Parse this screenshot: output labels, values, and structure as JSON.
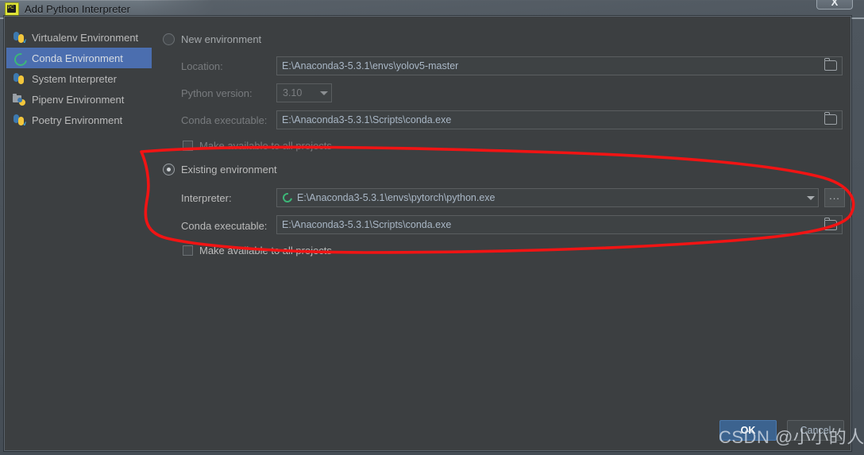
{
  "window": {
    "title": "Add Python Interpreter",
    "app_icon": "pycharm-icon",
    "close_label": "X"
  },
  "sidebar": {
    "items": [
      {
        "label": "Virtualenv Environment",
        "icon": "virtualenv-icon",
        "selected": false
      },
      {
        "label": "Conda Environment",
        "icon": "conda-icon",
        "selected": true
      },
      {
        "label": "System Interpreter",
        "icon": "python-icon",
        "selected": false
      },
      {
        "label": "Pipenv Environment",
        "icon": "pipenv-icon",
        "selected": false
      },
      {
        "label": "Poetry Environment",
        "icon": "poetry-icon",
        "selected": false
      }
    ]
  },
  "new_environment": {
    "radio_label": "New environment",
    "selected": false,
    "location_label": "Location:",
    "location_value": "E:\\Anaconda3-5.3.1\\envs\\yolov5-master",
    "python_version_label": "Python version:",
    "python_version_value": "3.10",
    "conda_executable_label": "Conda executable:",
    "conda_executable_value": "E:\\Anaconda3-5.3.1\\Scripts\\conda.exe",
    "make_available_label": "Make available to all projects",
    "make_available_checked": false
  },
  "existing_environment": {
    "radio_label": "Existing environment",
    "selected": true,
    "interpreter_label": "Interpreter:",
    "interpreter_value": "E:\\Anaconda3-5.3.1\\envs\\pytorch\\python.exe",
    "interpreter_icon": "conda-icon",
    "browse_label": "...",
    "conda_executable_label": "Conda executable:",
    "conda_executable_value": "E:\\Anaconda3-5.3.1\\Scripts\\conda.exe",
    "make_available_label": "Make available to all projects",
    "make_available_checked": false
  },
  "footer": {
    "ok_label": "OK",
    "cancel_label": "Cancel"
  },
  "watermark": {
    "text": "CSDN @小小的人"
  },
  "colors": {
    "dialog_bg": "#3c3f41",
    "selection_blue": "#4b6eaf",
    "ok_button": "#3c638f",
    "field_text": "#a9b7c6",
    "annotation_red": "#f11414",
    "conda_green": "#3cb878"
  }
}
